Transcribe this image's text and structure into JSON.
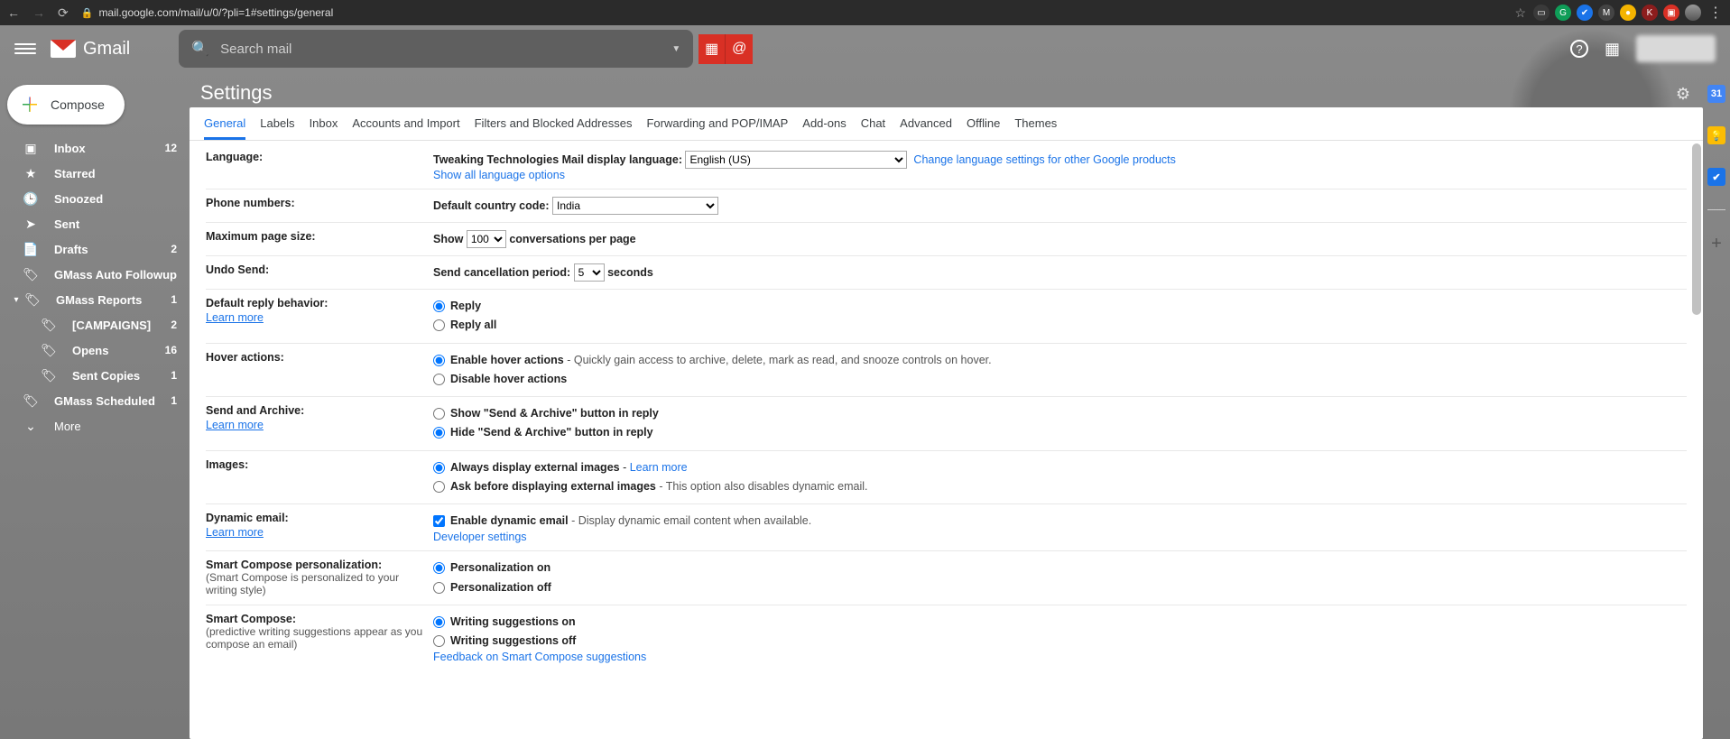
{
  "browser": {
    "url": "mail.google.com/mail/u/0/?pli=1#settings/general"
  },
  "header": {
    "brand": "Gmail",
    "search_placeholder": "Search mail"
  },
  "compose": {
    "label": "Compose"
  },
  "sidebar": {
    "items": [
      {
        "icon": "inbox",
        "label": "Inbox",
        "count": "12"
      },
      {
        "icon": "star",
        "label": "Starred",
        "count": ""
      },
      {
        "icon": "clock",
        "label": "Snoozed",
        "count": ""
      },
      {
        "icon": "send",
        "label": "Sent",
        "count": ""
      },
      {
        "icon": "draft",
        "label": "Drafts",
        "count": "2"
      },
      {
        "icon": "label",
        "label": "GMass Auto Followup",
        "count": ""
      },
      {
        "icon": "label",
        "label": "GMass Reports",
        "count": "1",
        "expandable": true
      },
      {
        "icon": "label-sub",
        "label": "[CAMPAIGNS]",
        "count": "2"
      },
      {
        "icon": "label-sub",
        "label": "Opens",
        "count": "16"
      },
      {
        "icon": "label-sub",
        "label": "Sent Copies",
        "count": "1"
      },
      {
        "icon": "label",
        "label": "GMass Scheduled",
        "count": "1"
      },
      {
        "icon": "more",
        "label": "More",
        "count": ""
      }
    ]
  },
  "settings": {
    "title": "Settings",
    "tabs": [
      "General",
      "Labels",
      "Inbox",
      "Accounts and Import",
      "Filters and Blocked Addresses",
      "Forwarding and POP/IMAP",
      "Add-ons",
      "Chat",
      "Advanced",
      "Offline",
      "Themes"
    ],
    "language": {
      "label": "Language:",
      "display_label": "Tweaking Technologies Mail display language:",
      "value": "English (US)",
      "show_all": "Show all language options",
      "change_other": "Change language settings for other Google products"
    },
    "phone": {
      "label": "Phone numbers:",
      "default_label": "Default country code:",
      "value": "India"
    },
    "page_size": {
      "label": "Maximum page size:",
      "show": "Show",
      "value": "100",
      "suffix": "conversations per page"
    },
    "undo": {
      "label": "Undo Send:",
      "period_label": "Send cancellation period:",
      "value": "5",
      "suffix": "seconds"
    },
    "default_reply": {
      "label": "Default reply behavior:",
      "learn_more": "Learn more",
      "opt1": "Reply",
      "opt2": "Reply all"
    },
    "hover": {
      "label": "Hover actions:",
      "opt1": "Enable hover actions",
      "opt1_desc": " - Quickly gain access to archive, delete, mark as read, and snooze controls on hover.",
      "opt2": "Disable hover actions"
    },
    "send_archive": {
      "label": "Send and Archive:",
      "learn_more": "Learn more",
      "opt1": "Show \"Send & Archive\" button in reply",
      "opt2": "Hide \"Send & Archive\" button in reply"
    },
    "images": {
      "label": "Images:",
      "opt1": "Always display external images",
      "opt1_link": "Learn more",
      "opt2": "Ask before displaying external images",
      "opt2_desc": " - This option also disables dynamic email."
    },
    "dynamic": {
      "label": "Dynamic email:",
      "learn_more": "Learn more",
      "opt1": "Enable dynamic email",
      "opt1_desc": " - Display dynamic email content when available.",
      "dev": "Developer settings"
    },
    "smart_personal": {
      "label": "Smart Compose personalization:",
      "sub": "(Smart Compose is personalized to your writing style)",
      "opt1": "Personalization on",
      "opt2": "Personalization off"
    },
    "smart_compose": {
      "label": "Smart Compose:",
      "sub": "(predictive writing suggestions appear as you compose an email)",
      "opt1": "Writing suggestions on",
      "opt2": "Writing suggestions off",
      "feedback": "Feedback on Smart Compose suggestions"
    }
  }
}
